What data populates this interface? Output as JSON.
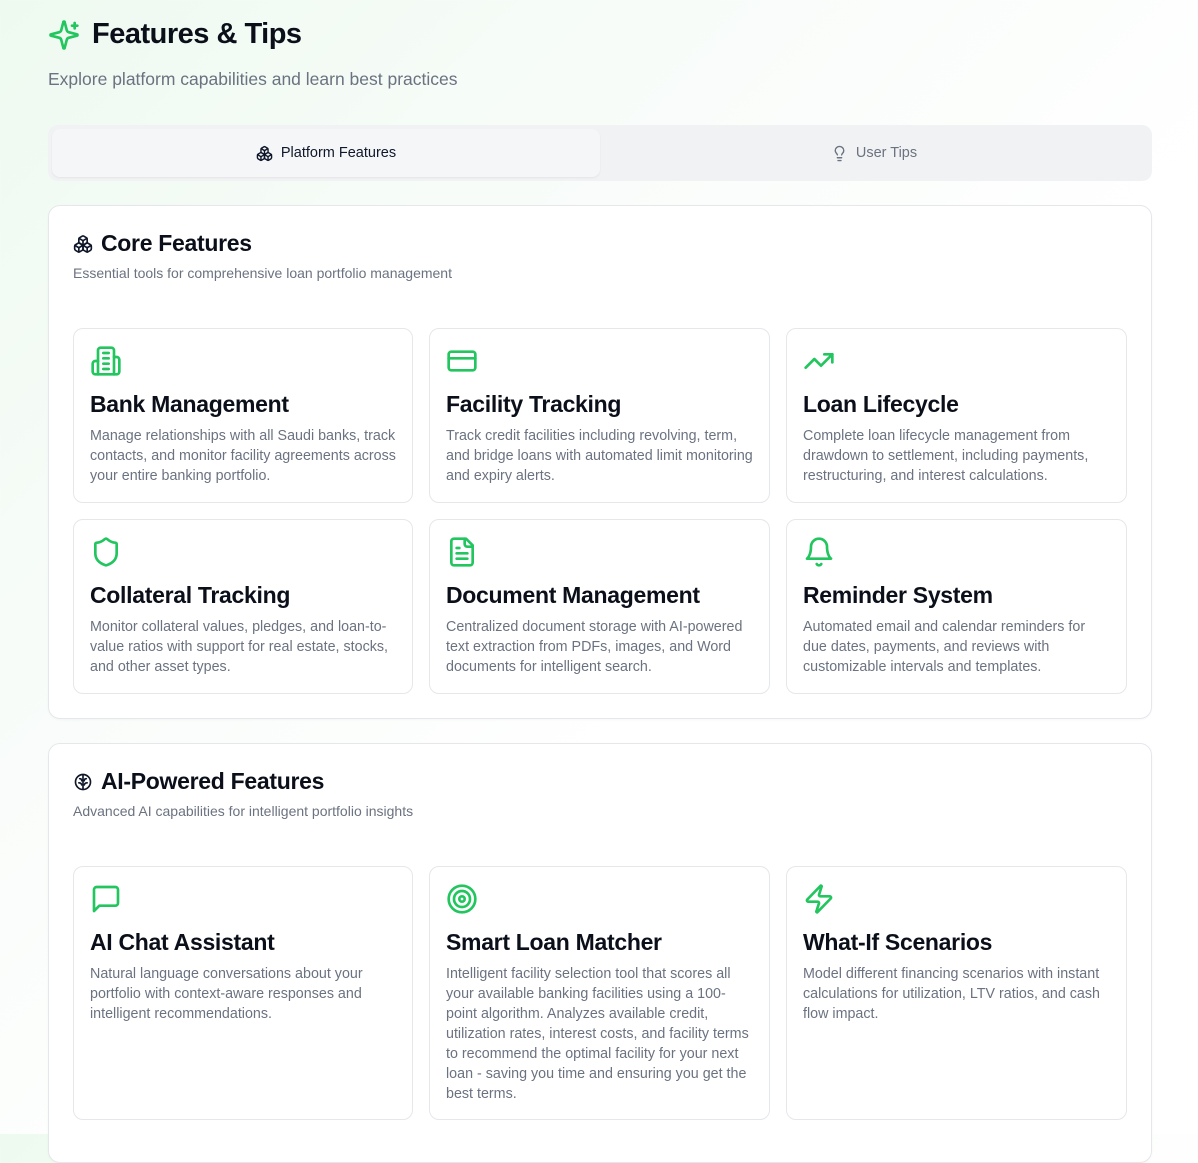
{
  "header": {
    "title": "Features & Tips",
    "subtitle": "Explore platform capabilities and learn best practices",
    "icon": "sparkles-icon"
  },
  "tabs": [
    {
      "label": "Platform Features",
      "icon": "boxes-icon",
      "active": true
    },
    {
      "label": "User Tips",
      "icon": "lightbulb-icon",
      "active": false
    }
  ],
  "accent_color": "#22c55e",
  "core": {
    "title": "Core Features",
    "description": "Essential tools for comprehensive loan portfolio management",
    "icon": "boxes-icon",
    "items": [
      {
        "title": "Bank Management",
        "icon": "building-icon",
        "description": "Manage relationships with all Saudi banks, track contacts, and monitor facility agreements across your entire banking portfolio."
      },
      {
        "title": "Facility Tracking",
        "icon": "credit-card-icon",
        "description": "Track credit facilities including revolving, term, and bridge loans with automated limit monitoring and expiry alerts."
      },
      {
        "title": "Loan Lifecycle",
        "icon": "trending-up-icon",
        "description": "Complete loan lifecycle management from drawdown to settlement, including payments, restructuring, and interest calculations."
      },
      {
        "title": "Collateral Tracking",
        "icon": "shield-icon",
        "description": "Monitor collateral values, pledges, and loan-to-value ratios with support for real estate, stocks, and other asset types."
      },
      {
        "title": "Document Management",
        "icon": "file-text-icon",
        "description": "Centralized document storage with AI-powered text extraction from PDFs, images, and Word documents for intelligent search."
      },
      {
        "title": "Reminder System",
        "icon": "bell-icon",
        "description": "Automated email and calendar reminders for due dates, payments, and reviews with customizable intervals and templates."
      }
    ]
  },
  "ai": {
    "title": "AI-Powered Features",
    "description": "Advanced AI capabilities for intelligent portfolio insights",
    "icon": "brain-icon",
    "items": [
      {
        "title": "AI Chat Assistant",
        "icon": "message-square-icon",
        "description": "Natural language conversations about your portfolio with context-aware responses and intelligent recommendations."
      },
      {
        "title": "Smart Loan Matcher",
        "icon": "target-icon",
        "description": "Intelligent facility selection tool that scores all your available banking facilities using a 100-point algorithm. Analyzes available credit, utilization rates, interest costs, and facility terms to recommend the optimal facility for your next loan - saving you time and ensuring you get the best terms."
      },
      {
        "title": "What-If Scenarios",
        "icon": "zap-icon",
        "description": "Model different financing scenarios with instant calculations for utilization, LTV ratios, and cash flow impact."
      }
    ]
  }
}
